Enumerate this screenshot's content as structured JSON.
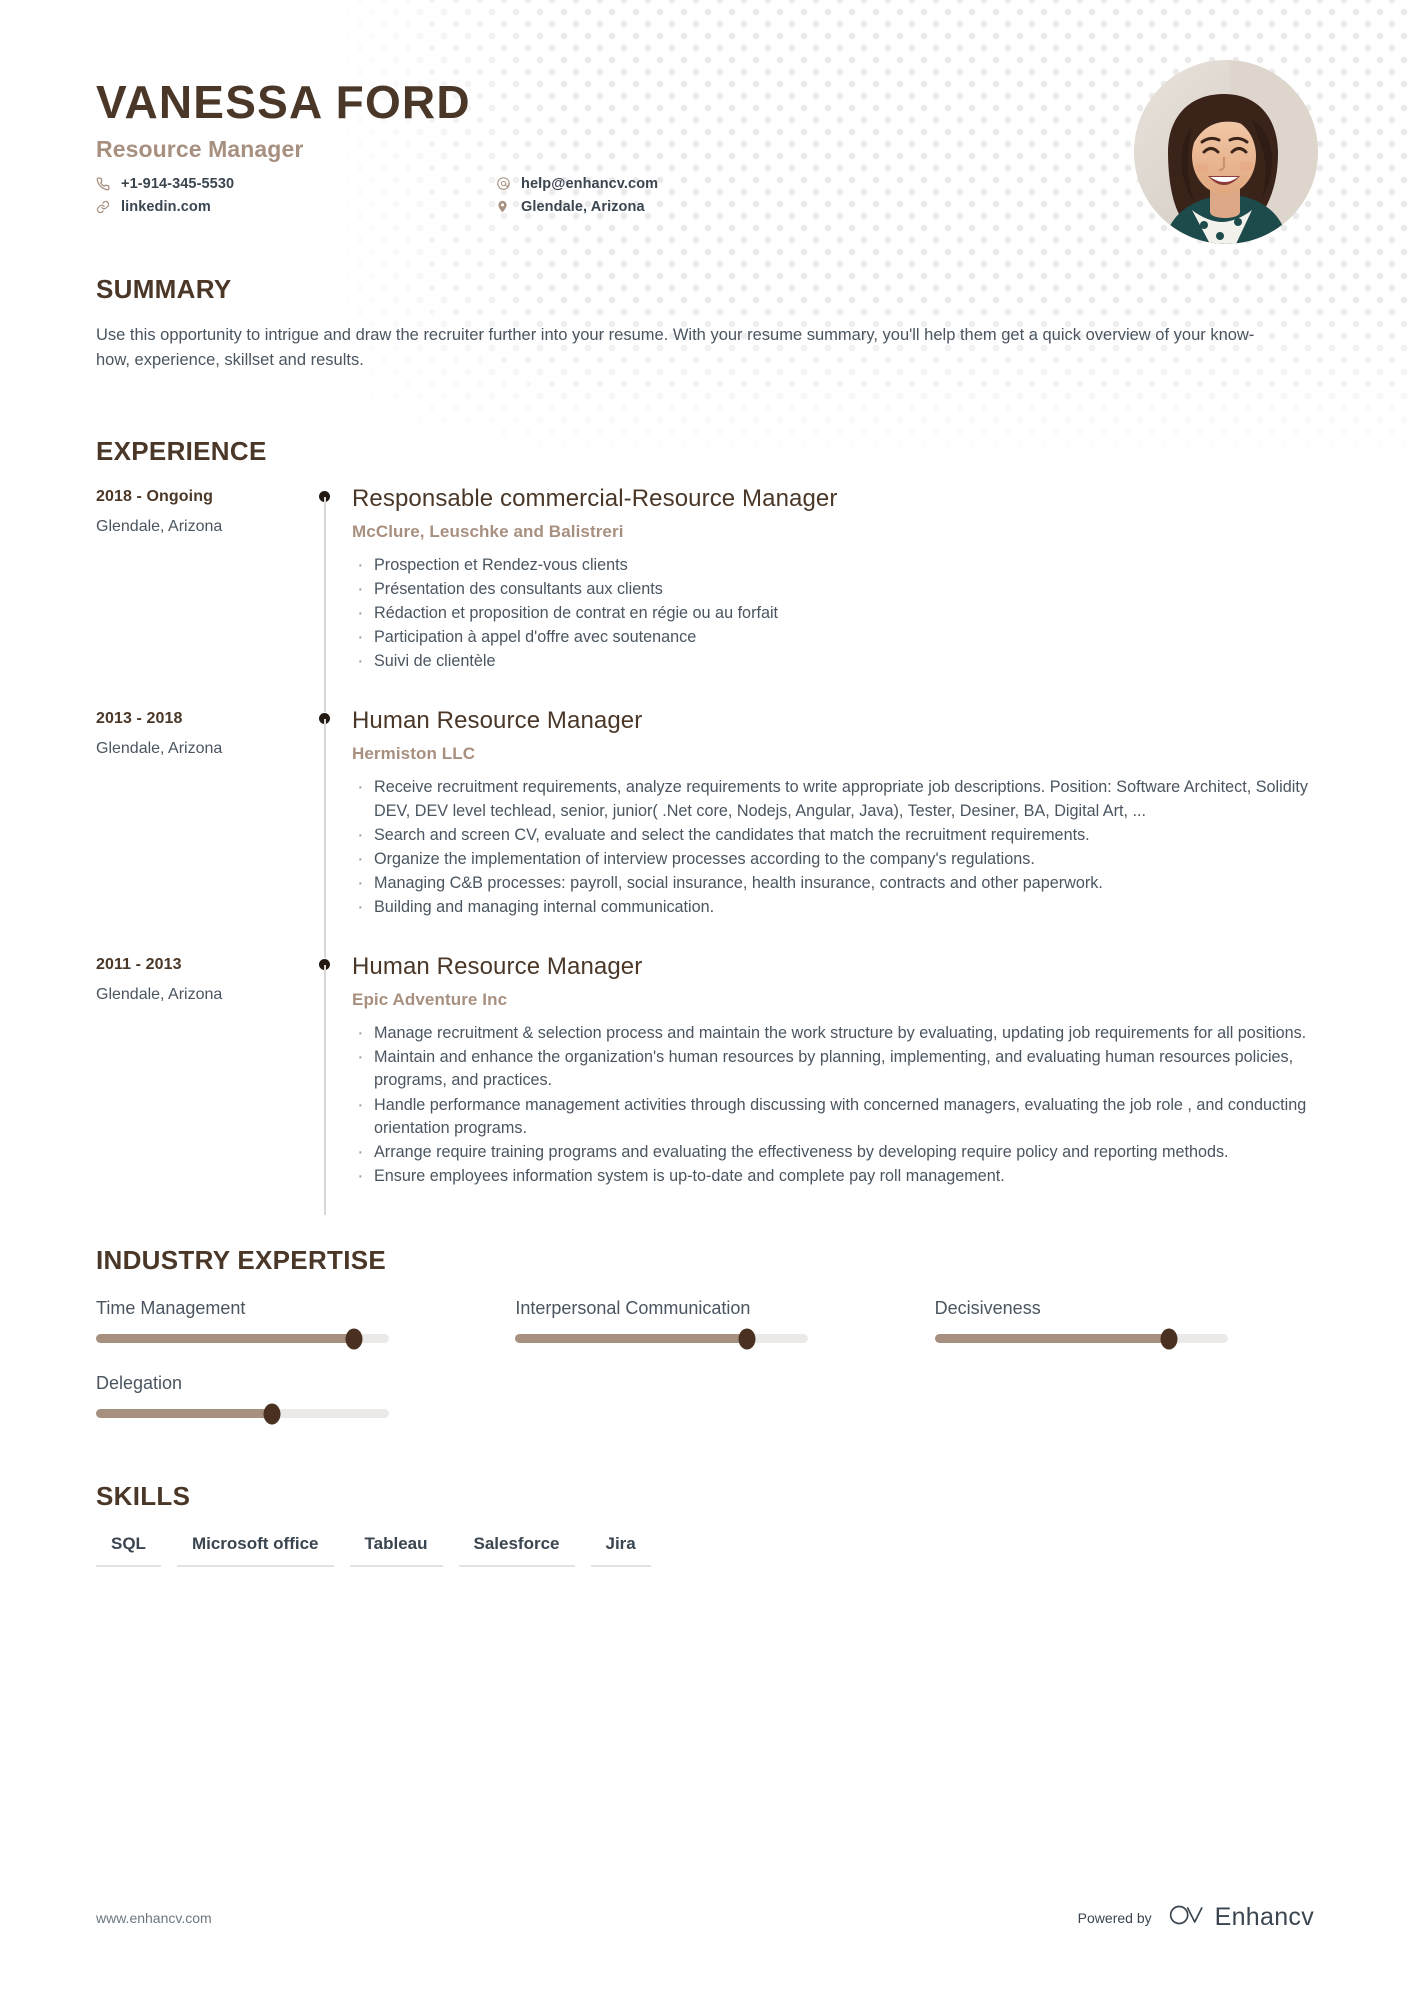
{
  "header": {
    "name": "VANESSA FORD",
    "role": "Resource Manager",
    "contacts": [
      {
        "icon": "phone-icon",
        "text": "+1-914-345-5530"
      },
      {
        "icon": "email-icon",
        "text": "help@enhancv.com"
      },
      {
        "icon": "link-icon",
        "text": "linkedin.com"
      },
      {
        "icon": "location-icon",
        "text": "Glendale, Arizona"
      }
    ]
  },
  "summary": {
    "title": "SUMMARY",
    "body": "Use this opportunity to intrigue and draw the recruiter further into your resume. With your resume summary, you'll help them get a quick overview of your know-how, experience, skillset and results."
  },
  "experience": {
    "title": "EXPERIENCE",
    "items": [
      {
        "dates": "2018 - Ongoing",
        "location": "Glendale, Arizona",
        "job_title": "Responsable commercial-Resource Manager",
        "company": "McClure, Leuschke and Balistreri",
        "bullets": [
          "Prospection et Rendez-vous clients",
          "Présentation des consultants aux clients",
          "Rédaction et proposition de contrat en régie ou au forfait",
          "Participation à appel d'offre avec soutenance",
          "Suivi de clientèle"
        ]
      },
      {
        "dates": "2013 - 2018",
        "location": "Glendale, Arizona",
        "job_title": "Human Resource Manager",
        "company": "Hermiston LLC",
        "bullets": [
          "Receive recruitment requirements, analyze requirements to write appropriate job descriptions. Position: Software Architect, Solidity DEV,  DEV level techlead, senior, junior( .Net core, Nodejs, Angular, Java), Tester, Desiner, BA, Digital Art, ...",
          "Search and screen CV, evaluate and select the candidates that match the recruitment requirements.",
          "Organize the implementation of interview processes according to the company's regulations.",
          "Managing C&B processes: payroll, social insurance, health insurance, contracts and other paperwork.",
          "Building and managing internal communication."
        ]
      },
      {
        "dates": "2011 - 2013",
        "location": "Glendale, Arizona",
        "job_title": "Human Resource Manager",
        "company": "Epic Adventure Inc",
        "bullets": [
          "Manage recruitment &  selection process and maintain the work structure by evaluating, updating job requirements for all positions.",
          "Maintain and enhance the organization's human resources by planning, implementing, and evaluating human resources policies, programs, and practices.",
          "Handle performance management activities through discussing with concerned managers, evaluating the job role , and conducting orientation programs.",
          "Arrange require training programs and evaluating the effectiveness by developing require policy and reporting methods.",
          "Ensure employees information system is up-to-date and complete pay roll management."
        ]
      }
    ]
  },
  "expertise": {
    "title": "INDUSTRY EXPERTISE",
    "items": [
      {
        "label": "Time Management",
        "value": 88
      },
      {
        "label": "Interpersonal Communication",
        "value": 79
      },
      {
        "label": "Decisiveness",
        "value": 80
      },
      {
        "label": "Delegation",
        "value": 60
      }
    ]
  },
  "skills": {
    "title": "SKILLS",
    "tags": [
      "SQL",
      "Microsoft office",
      "Tableau",
      "Salesforce",
      "Jira"
    ]
  },
  "footer": {
    "url": "www.enhancv.com",
    "powered_by": "Powered by",
    "brand": "Enhancv"
  },
  "colors": {
    "dark_brown": "#4a3728",
    "taupe": "#a89080",
    "body_text": "#4a5560",
    "slate": "#3a4550",
    "track": "#eceae8",
    "knob": "#4a3021"
  }
}
